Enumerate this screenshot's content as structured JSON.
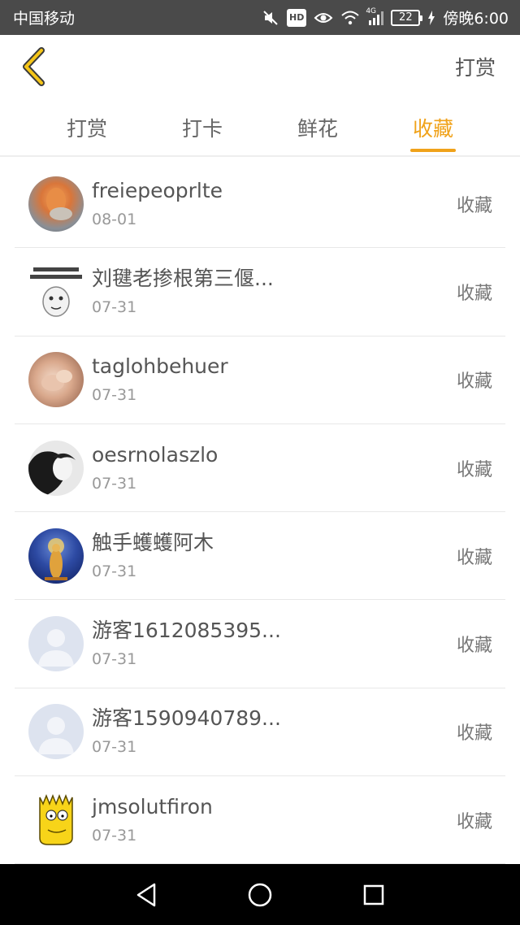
{
  "status_bar": {
    "carrier": "中国移动",
    "network": "4G",
    "battery": "22",
    "time": "傍晚6:00",
    "hd_label": "HD"
  },
  "header": {
    "back_icon": "chevron-left-icon",
    "action_label": "打赏"
  },
  "tabs": [
    {
      "label": "打赏",
      "active": false
    },
    {
      "label": "打卡",
      "active": false
    },
    {
      "label": "鲜花",
      "active": false
    },
    {
      "label": "收藏",
      "active": true
    }
  ],
  "accent_color": "#f0a21a",
  "list": [
    {
      "name": "freiepeoprlte",
      "date": "08-01",
      "status": "收藏",
      "avatar": "photo-squirrel"
    },
    {
      "name": "刘毽老掺根第三偃...",
      "date": "07-31",
      "status": "收藏",
      "avatar": "meme-face"
    },
    {
      "name": "taglohbehuer",
      "date": "07-31",
      "status": "收藏",
      "avatar": "photo-hands"
    },
    {
      "name": "oesrnolaszlo",
      "date": "07-31",
      "status": "收藏",
      "avatar": "photo-portrait-bw"
    },
    {
      "name": "触手蠖蠖阿木",
      "date": "07-31",
      "status": "收藏",
      "avatar": "photo-buddha"
    },
    {
      "name": "游客1612085395...",
      "date": "07-31",
      "status": "收藏",
      "avatar": "default-user"
    },
    {
      "name": "游客1590940789...",
      "date": "07-31",
      "status": "收藏",
      "avatar": "default-user"
    },
    {
      "name": "jmsolutfiron",
      "date": "07-31",
      "status": "收藏",
      "avatar": "cartoon-character"
    }
  ],
  "nav_bar": {
    "back_icon": "triangle-back-icon",
    "home_icon": "circle-home-icon",
    "recents_icon": "square-recents-icon"
  }
}
